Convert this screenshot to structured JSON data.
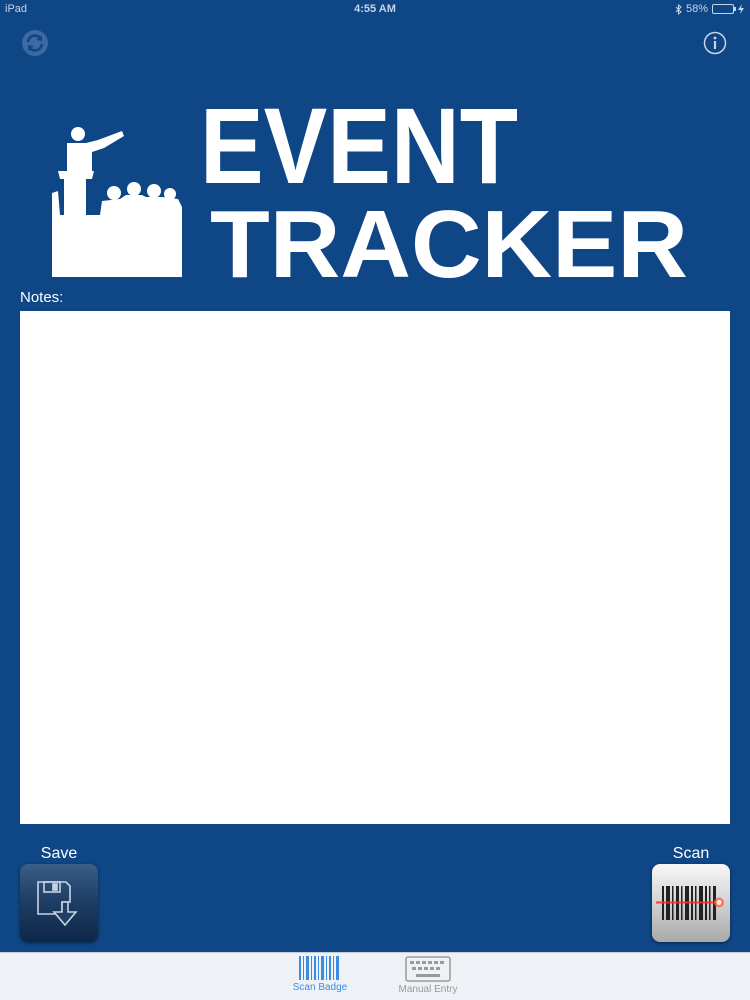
{
  "status_bar": {
    "device": "iPad",
    "time": "4:55 AM",
    "battery": "58%",
    "battery_level": 0.58
  },
  "toolbar": {
    "refresh_icon": "refresh-icon",
    "info_icon": "info-icon"
  },
  "logo": {
    "line1": "EVENT",
    "line2": "TRACKER"
  },
  "notes": {
    "label": "Notes:",
    "value": "",
    "placeholder": ""
  },
  "actions": {
    "save_label": "Save",
    "save_icon": "floppy-save-icon",
    "scan_label": "Scan",
    "scan_icon": "barcode-scanner-icon"
  },
  "tab_bar": {
    "tabs": [
      {
        "label": "Scan Badge",
        "icon": "barcode-icon",
        "selected": true
      },
      {
        "label": "Manual Entry",
        "icon": "keyboard-icon",
        "selected": false
      }
    ]
  },
  "colors": {
    "background": "#0f4685",
    "active_tab": "#3b8de4",
    "inactive_tab": "#9a9a9a"
  }
}
